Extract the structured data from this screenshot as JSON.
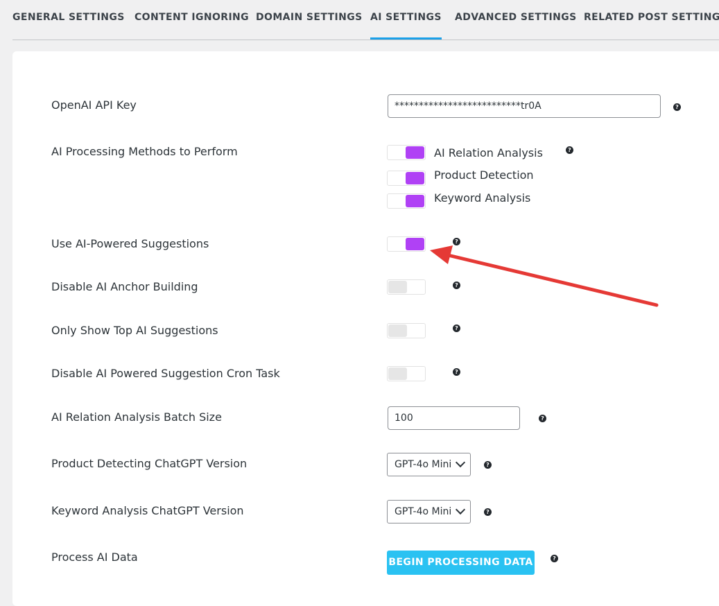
{
  "tabs": [
    {
      "label": "GENERAL SETTINGS"
    },
    {
      "label": "CONTENT IGNORING"
    },
    {
      "label": "DOMAIN SETTINGS"
    },
    {
      "label": "AI SETTINGS"
    },
    {
      "label": "ADVANCED SETTINGS"
    },
    {
      "label": "RELATED POST SETTINGS"
    }
  ],
  "active_tab": "AI SETTINGS",
  "settings": {
    "api_key": {
      "label": "OpenAI API Key",
      "value": "**************************tr0A",
      "help": "?"
    },
    "methods": {
      "label": "AI Processing Methods to Perform",
      "help": "?",
      "options": [
        {
          "label": "AI Relation Analysis",
          "enabled": true
        },
        {
          "label": "Product Detection",
          "enabled": true
        },
        {
          "label": "Keyword Analysis",
          "enabled": true
        }
      ]
    },
    "use_suggestions": {
      "label": "Use AI-Powered Suggestions",
      "enabled": true,
      "help": "?"
    },
    "disable_anchor": {
      "label": "Disable AI Anchor Building",
      "enabled": false,
      "help": "?"
    },
    "top_only": {
      "label": "Only Show Top AI Suggestions",
      "enabled": false,
      "help": "?"
    },
    "disable_cron": {
      "label": "Disable AI Powered Suggestion Cron Task",
      "enabled": false,
      "help": "?"
    },
    "batch_size": {
      "label": "AI Relation Analysis Batch Size",
      "value": "100",
      "help": "?"
    },
    "product_model": {
      "label": "Product Detecting ChatGPT Version",
      "value": "GPT-4o Mini",
      "help": "?"
    },
    "keyword_model": {
      "label": "Keyword Analysis ChatGPT Version",
      "value": "GPT-4o Mini",
      "help": "?"
    },
    "process": {
      "label": "Process AI Data",
      "button_label": "BEGIN PROCESSING DATA",
      "help": "?"
    }
  },
  "colors": {
    "toggle_on": "#b041f5",
    "toggle_off": "#e6e6e6",
    "tab_active_underline": "#1ba0e8",
    "button_bg": "#2ac2f2",
    "annotation_arrow": "#e53935"
  }
}
